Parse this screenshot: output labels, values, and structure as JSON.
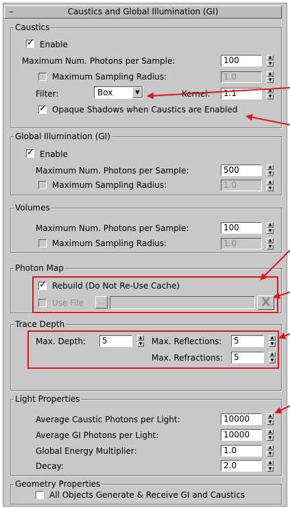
{
  "header": {
    "title": "Caustics and Global Illumination (GI)",
    "collapse": "–"
  },
  "caustics": {
    "title": "Caustics",
    "enable_label": "Enable",
    "max_photons_label": "Maximum Num. Photons per Sample:",
    "max_photons_value": "100",
    "max_radius_label": "Maximum Sampling Radius:",
    "max_radius_value": "1.0",
    "filter_label": "Filter:",
    "filter_value": "Box",
    "kernel_label": "Kernel:",
    "kernel_value": "1.1",
    "opaque_label": "Opaque Shadows when Caustics are Enabled"
  },
  "gi": {
    "title": "Global Illumination (GI)",
    "enable_label": "Enable",
    "max_photons_label": "Maximum Num. Photons per Sample:",
    "max_photons_value": "500",
    "max_radius_label": "Maximum Sampling Radius:",
    "max_radius_value": "1.0"
  },
  "volumes": {
    "title": "Volumes",
    "max_photons_label": "Maximum Num. Photons per Sample:",
    "max_photons_value": "100",
    "max_radius_label": "Maximum Sampling Radius:",
    "max_radius_value": "1.0"
  },
  "photon_map": {
    "title": "Photon Map",
    "rebuild_label": "Rebuild (Do Not Re-Use Cache)",
    "use_file_label": "Use File",
    "browse_label": "..."
  },
  "trace_depth": {
    "title": "Trace Depth",
    "max_depth_label": "Max. Depth:",
    "max_depth_value": "5",
    "max_reflections_label": "Max. Reflections:",
    "max_reflections_value": "5",
    "max_refractions_label": "Max. Refractions:",
    "max_refractions_value": "5"
  },
  "light": {
    "title": "Light Properties",
    "avg_caustic_label": "Average Caustic Photons per Light:",
    "avg_caustic_value": "10000",
    "avg_gi_label": "Average GI Photons per Light:",
    "avg_gi_value": "10000",
    "energy_label": "Global Energy Multiplier:",
    "energy_value": "1.0",
    "decay_label": "Decay:",
    "decay_value": "2.0"
  },
  "geometry": {
    "title": "Geometry Properties",
    "all_objects_label": "All Objects Generate & Receive GI and Caustics"
  },
  "colors": {
    "annotation_red": "#e0141e",
    "panel_bg": "#c8c8c8"
  }
}
